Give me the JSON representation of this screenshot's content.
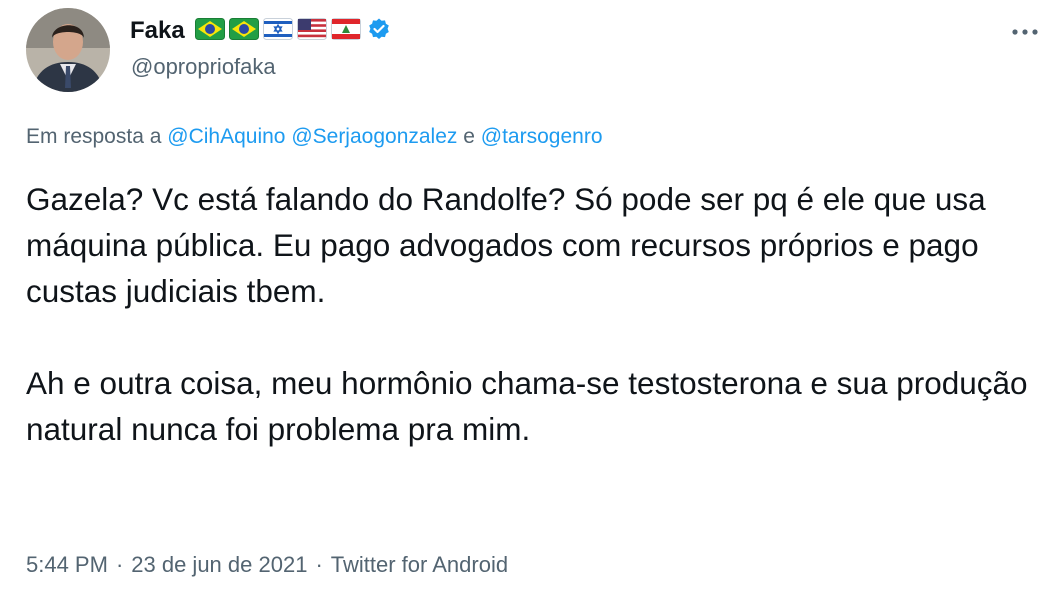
{
  "author": {
    "display_name": "Faka",
    "handle": "@opropriofaka",
    "flags": [
      "brazil-flag",
      "brazil-flag",
      "israel-flag",
      "usa-flag",
      "lebanon-flag"
    ],
    "verified": true
  },
  "reply": {
    "prefix": "Em resposta a",
    "mention_1": "@CihAquino",
    "mention_2": "@Serjaogonzalez",
    "conjunction": "e",
    "mention_3": "@tarsogenro"
  },
  "body": {
    "paragraph_1": "Gazela? Vc está falando do Randolfe? Só pode ser pq é ele que usa máquina pública. Eu pago advogados com recursos próprios e pago custas judiciais tbem.",
    "paragraph_2": "Ah e outra coisa, meu hormônio chama-se testosterona e sua produção natural nunca foi problema pra mim."
  },
  "meta": {
    "time": "5:44 PM",
    "separator": "·",
    "date": "23 de jun de 2021",
    "source": "Twitter for Android"
  },
  "colors": {
    "text": "#0f1419",
    "secondary": "#536471",
    "link": "#1d9bf0"
  }
}
